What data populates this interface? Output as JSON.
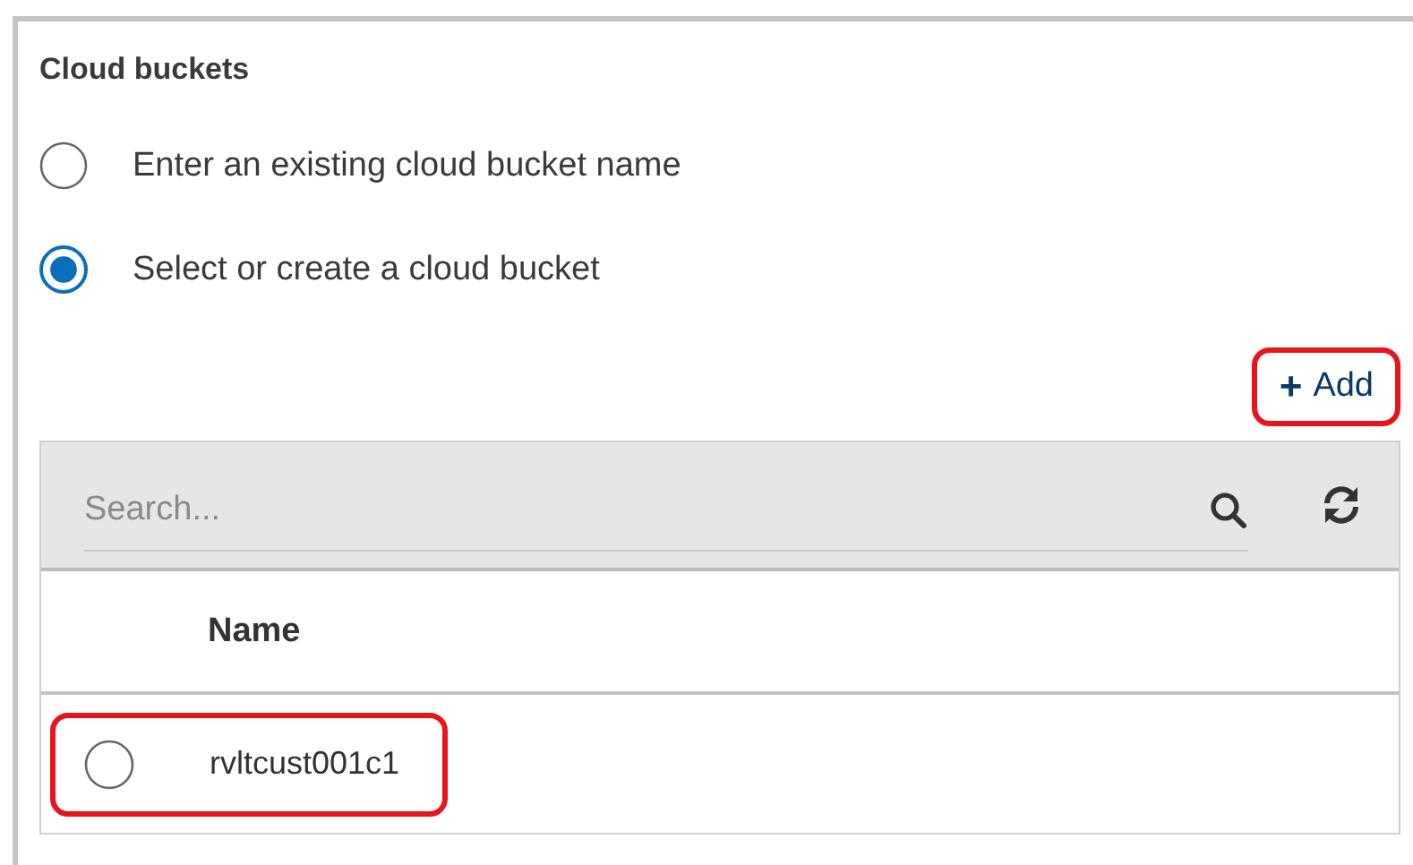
{
  "section": {
    "title": "Cloud buckets"
  },
  "options": [
    {
      "label": "Enter an existing cloud bucket name",
      "selected": false
    },
    {
      "label": "Select or create a cloud bucket",
      "selected": true
    }
  ],
  "add_button": {
    "icon": "+",
    "label": "Add",
    "highlighted": true
  },
  "search": {
    "placeholder": "Search..."
  },
  "table": {
    "columns": [
      "Name"
    ],
    "rows": [
      {
        "name": "rvltcust001c1",
        "selected": false,
        "highlighted": true
      }
    ]
  }
}
